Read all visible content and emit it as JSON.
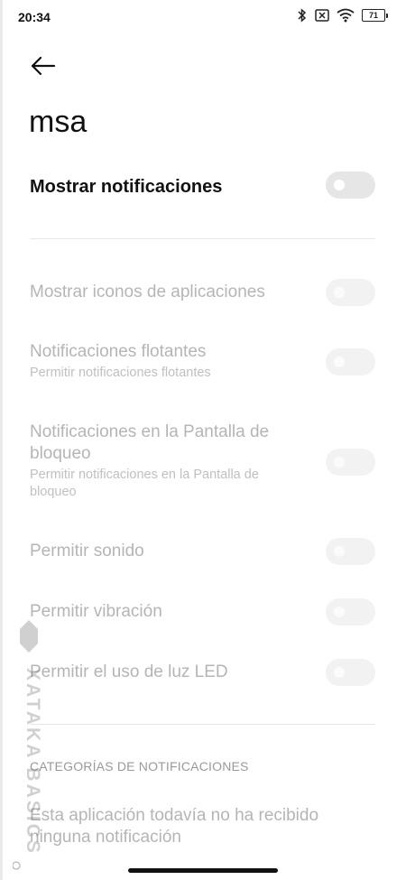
{
  "status_bar": {
    "time": "20:34",
    "battery": "71",
    "icons": [
      "bluetooth-icon",
      "sim-off-icon",
      "wifi-icon",
      "battery-icon"
    ]
  },
  "header": {
    "back_icon": "arrow-left-icon",
    "app_name": "msa"
  },
  "main_toggle": {
    "label": "Mostrar notificaciones",
    "enabled": false
  },
  "settings": [
    {
      "label": "Mostrar iconos de aplicaciones",
      "sub": "",
      "enabled": false
    },
    {
      "label": "Notificaciones flotantes",
      "sub": "Permitir notificaciones flotantes",
      "enabled": false
    },
    {
      "label": "Notificaciones en la Pantalla de bloqueo",
      "sub": "Permitir notificaciones en la Pantalla de bloqueo",
      "enabled": false
    },
    {
      "label": "Permitir sonido",
      "sub": "",
      "enabled": false
    },
    {
      "label": "Permitir vibración",
      "sub": "",
      "enabled": false
    },
    {
      "label": "Permitir el uso de luz LED",
      "sub": "",
      "enabled": false
    }
  ],
  "categories": {
    "header": "CATEGORÍAS DE NOTIFICACIONES",
    "empty_message": "Esta aplicación todavía no ha recibido ninguna notificación"
  },
  "watermark": {
    "text": "XATAKA BASICS"
  },
  "colors": {
    "background": "#ffffff",
    "text_primary": "#111111",
    "text_disabled": "#b5b5b5",
    "toggle_off": "#f2f2f2"
  }
}
